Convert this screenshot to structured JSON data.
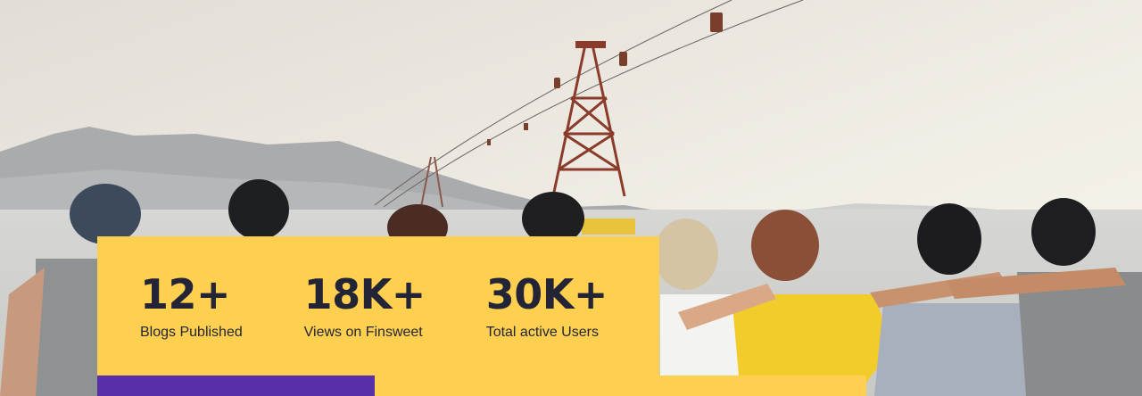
{
  "hero": {
    "image": "group-of-friends-by-the-sea-photo"
  },
  "stats": [
    {
      "value": "12+",
      "label": "Blogs Published"
    },
    {
      "value": "18K+",
      "label": "Views on Finsweet"
    },
    {
      "value": "30K+",
      "label": "Total active Users"
    }
  ],
  "colors": {
    "card": "#ffd050",
    "accent": "#592ea9",
    "text": "#232536"
  }
}
